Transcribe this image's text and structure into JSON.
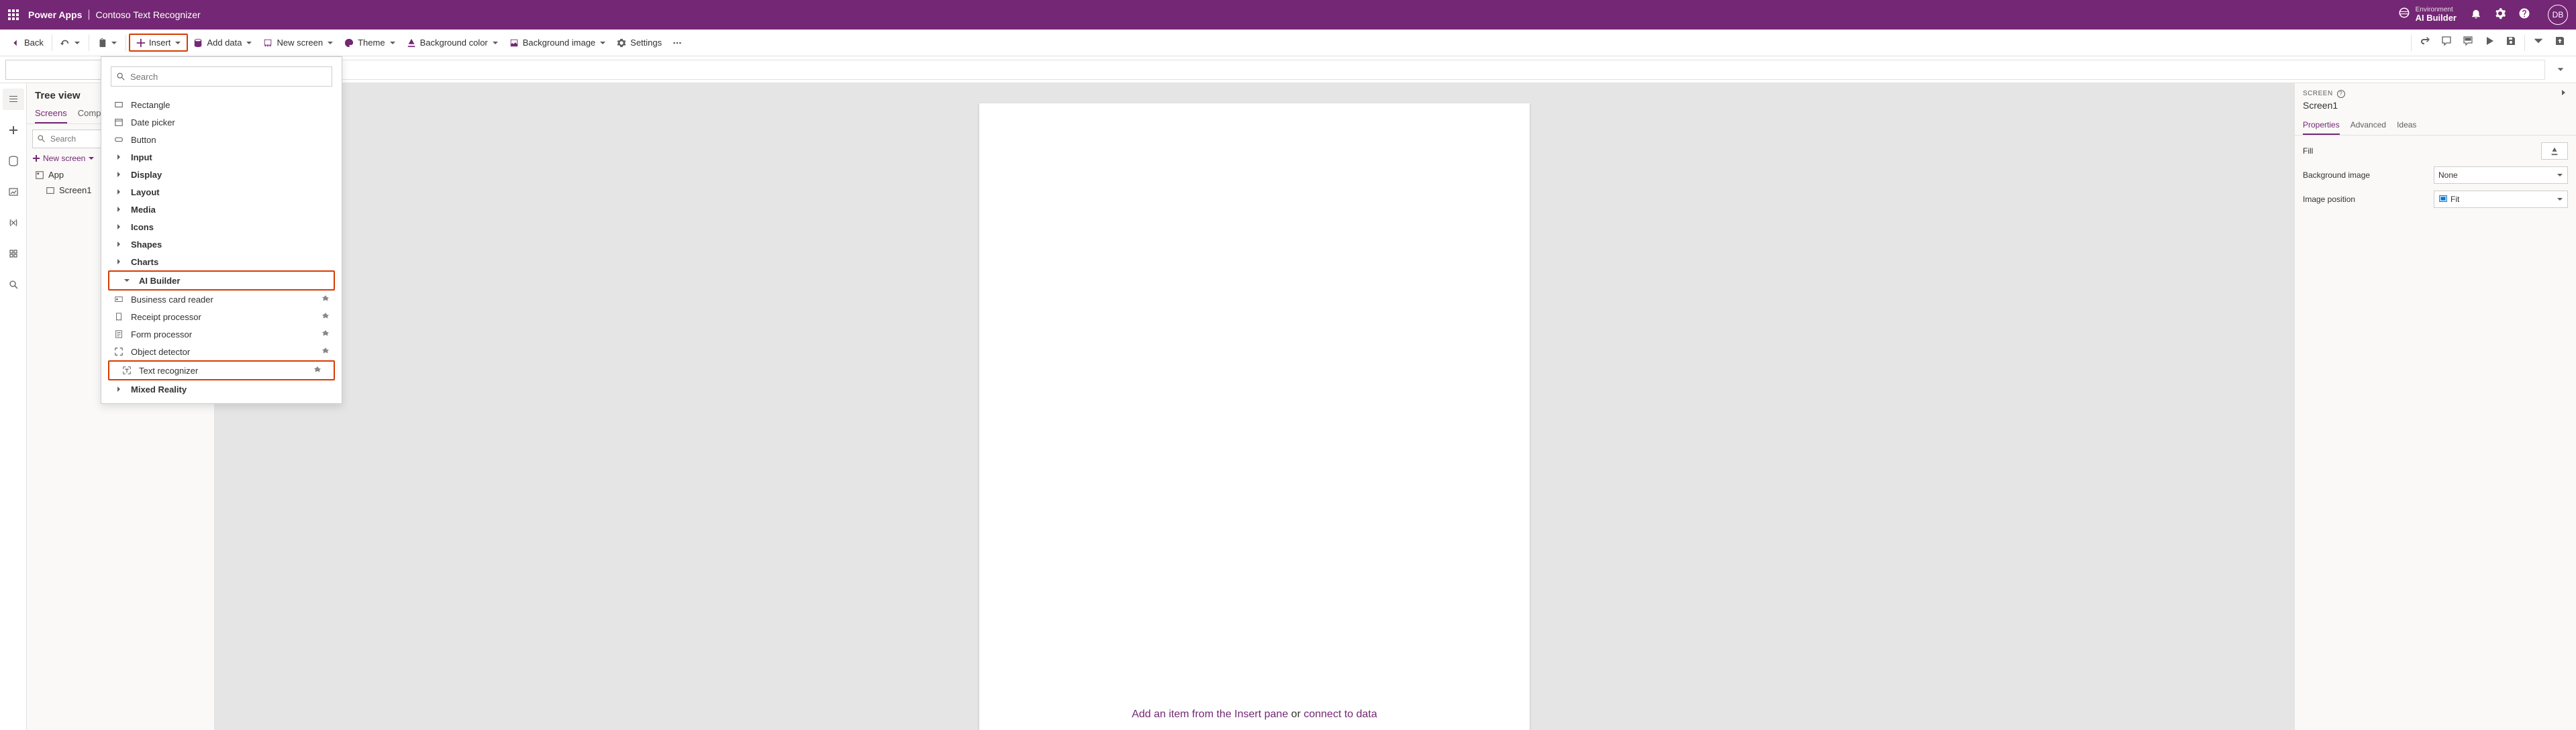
{
  "header": {
    "product": "Power Apps",
    "separator": "|",
    "appName": "Contoso Text Recognizer",
    "envLabel": "Environment",
    "envName": "AI Builder",
    "avatar": "DB"
  },
  "toolbar": {
    "back": "Back",
    "insert": "Insert",
    "addData": "Add data",
    "newScreen": "New screen",
    "theme": "Theme",
    "bgColor": "Background color",
    "bgImage": "Background image",
    "settings": "Settings"
  },
  "tree": {
    "title": "Tree view",
    "tabs": {
      "screens": "Screens",
      "components": "Components"
    },
    "searchPlaceholder": "Search",
    "newScreen": "New screen",
    "items": {
      "app": "App",
      "screen1": "Screen1"
    }
  },
  "insertMenu": {
    "searchPlaceholder": "Search",
    "rectangle": "Rectangle",
    "datePicker": "Date picker",
    "button": "Button",
    "input": "Input",
    "display": "Display",
    "layout": "Layout",
    "media": "Media",
    "icons": "Icons",
    "shapes": "Shapes",
    "charts": "Charts",
    "aiBuilder": "AI Builder",
    "businessCard": "Business card reader",
    "receipt": "Receipt processor",
    "form": "Form processor",
    "object": "Object detector",
    "text": "Text recognizer",
    "mixed": "Mixed Reality"
  },
  "canvas": {
    "hintA": "Add an item from the Insert pane",
    "hintOr": "or",
    "hintB": "connect to data"
  },
  "rpanel": {
    "label": "SCREEN",
    "name": "Screen1",
    "tabs": {
      "properties": "Properties",
      "advanced": "Advanced",
      "ideas": "Ideas"
    },
    "props": {
      "fill": "Fill",
      "bgImage": "Background image",
      "bgImageVal": "None",
      "imgPos": "Image position",
      "imgPosVal": "Fit"
    }
  }
}
